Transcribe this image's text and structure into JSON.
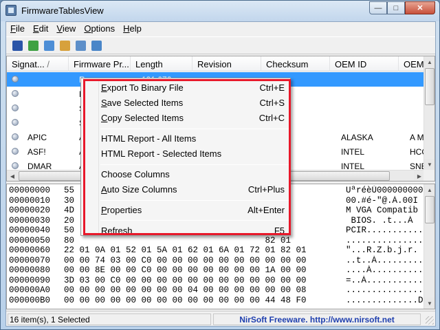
{
  "window": {
    "title": "FirmwareTablesView"
  },
  "titlebar": {
    "min_symbol": "—",
    "max_symbol": "□",
    "close_symbol": "✕"
  },
  "menubar": {
    "items": [
      {
        "first": "F",
        "rest": "ile"
      },
      {
        "first": "E",
        "rest": "dit"
      },
      {
        "first": "V",
        "rest": "iew"
      },
      {
        "first": "O",
        "rest": "ptions"
      },
      {
        "first": "H",
        "rest": "elp"
      }
    ]
  },
  "toolbar": {
    "icons": [
      "save-icon",
      "refresh-icon",
      "copy-icon",
      "html-report-icon",
      "properties-icon",
      "exit-icon"
    ],
    "colors": [
      "#2b55a8",
      "#3fa143",
      "#4d8ed6",
      "#d7a13c",
      "#5d8fc9",
      "#4a86c8"
    ]
  },
  "list": {
    "columns": [
      "Signat...",
      "Firmware Pr...",
      "Length",
      "Revision",
      "Checksum",
      "OEM ID",
      "OEM"
    ],
    "sort_arrow": "/",
    "rows": [
      {
        "sig": "",
        "fw": "R",
        "len": "131,072",
        "rev": "",
        "chk": "",
        "oem": "",
        "oemt": "",
        "selected": true
      },
      {
        "sig": "",
        "fw": "R",
        "len": "",
        "rev": "",
        "chk": "",
        "oem": "",
        "oemt": "",
        "selected": false
      },
      {
        "sig": "",
        "fw": "S",
        "len": "",
        "rev": "",
        "chk": "",
        "oem": "",
        "oemt": "",
        "selected": false
      },
      {
        "sig": "",
        "fw": "S",
        "len": "",
        "rev": "",
        "chk": "",
        "oem": "",
        "oemt": "",
        "selected": false
      },
      {
        "sig": "APIC",
        "fw": "A",
        "len": "",
        "rev": "",
        "chk": "",
        "oem": "ALASKA",
        "oemt": "A M",
        "selected": false
      },
      {
        "sig": "ASF!",
        "fw": "A",
        "len": "",
        "rev": "",
        "chk": "",
        "oem": "INTEL",
        "oemt": "HCG",
        "selected": false
      },
      {
        "sig": "DMAR",
        "fw": "A",
        "len": "",
        "rev": "",
        "chk": "",
        "oem": "INTEL",
        "oemt": "SNB",
        "selected": false
      }
    ]
  },
  "hex": {
    "lines": [
      {
        "addr": "00000000",
        "bytes": "55                                     30 30",
        "ascii": "UªréèÙ000000000"
      },
      {
        "addr": "00000010",
        "bytes": "30                                     49 42",
        "ascii": "00.#é-\"@.À.00I"
      },
      {
        "addr": "00000020",
        "bytes": "4D                                     6C 65",
        "ascii": "M VGA Compatib"
      },
      {
        "addr": "00000030",
        "bytes": "20                                     0B C0",
        "ascii": " BIOS. .t...À"
      },
      {
        "addr": "00000040",
        "bytes": "50                                     00 03",
        "ascii": "PCIR..........."
      },
      {
        "addr": "00000050",
        "bytes": "80                                     82 01",
        "ascii": "..............."
      },
      {
        "addr": "00000060",
        "bytes": "22 01 0A 01 52 01 5A 01 62 01 6A 01 72 01 82 01",
        "ascii": "\"...R.Z.b.j.r."
      },
      {
        "addr": "00000070",
        "bytes": "00 00 74 03 00 C0 00 00 00 00 00 00 00 00 00 00",
        "ascii": "..t..À........."
      },
      {
        "addr": "00000080",
        "bytes": "00 00 8E 00 00 C0 00 00 00 00 00 00 00 1A 00 00",
        "ascii": "....À.........."
      },
      {
        "addr": "00000090",
        "bytes": "3D 03 00 C0 00 00 00 00 00 00 00 00 00 00 00 00",
        "ascii": "=..À..........."
      },
      {
        "addr": "000000A0",
        "bytes": "00 00 00 00 00 00 00 00 04 00 00 00 00 00 00 08",
        "ascii": "..............."
      },
      {
        "addr": "000000B0",
        "bytes": "00 00 00 00 00 00 00 00 00 00 00 00 00 44 48 F0",
        "ascii": "..............D"
      }
    ]
  },
  "status": {
    "count": "16 item(s), 1 Selected",
    "credit": "NirSoft Freeware.  http://www.nirsoft.net"
  },
  "context_menu": {
    "items": [
      {
        "u": "E",
        "rest": "xport To Binary File",
        "shortcut": "Ctrl+E"
      },
      {
        "u": "S",
        "rest": "ave Selected Items",
        "shortcut": "Ctrl+S"
      },
      {
        "u": "C",
        "rest": "opy Selected Items",
        "shortcut": "Ctrl+C"
      },
      {
        "u": "",
        "rest": "HTML Report - All Items",
        "shortcut": ""
      },
      {
        "u": "",
        "rest": "HTML Report - Selected Items",
        "shortcut": ""
      },
      {
        "u": "",
        "rest": "Choose Columns",
        "shortcut": ""
      },
      {
        "u": "A",
        "rest": "uto Size Columns",
        "shortcut": "Ctrl+Plus"
      },
      {
        "u": "P",
        "rest": "roperties",
        "shortcut": "Alt+Enter"
      },
      {
        "u": "R",
        "rest": "efresh",
        "shortcut": "F5"
      }
    ]
  },
  "accent": {
    "selection": "#3399ff",
    "highlight_border": "#e8182a",
    "credit_text": "#1f3fae"
  }
}
